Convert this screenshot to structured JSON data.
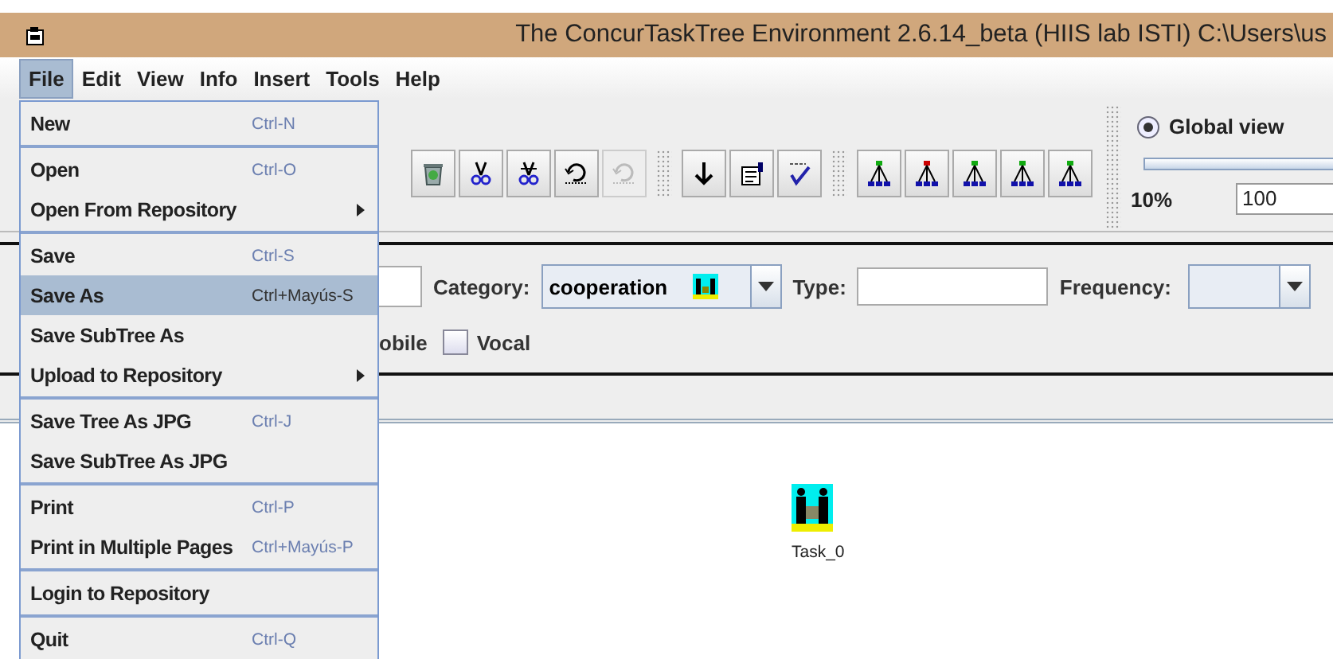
{
  "window": {
    "title": "The ConcurTaskTree Environment 2.6.14_beta (HIIS lab ISTI) C:\\Users\\us"
  },
  "menubar": [
    {
      "label": "File",
      "selected": true
    },
    {
      "label": "Edit",
      "selected": false
    },
    {
      "label": "View",
      "selected": false
    },
    {
      "label": "Info",
      "selected": false
    },
    {
      "label": "Insert",
      "selected": false
    },
    {
      "label": "Tools",
      "selected": false
    },
    {
      "label": "Help",
      "selected": false
    }
  ],
  "file_menu": {
    "groups": [
      [
        {
          "label": "New",
          "shortcut": "Ctrl-N",
          "selected": false,
          "submenu": false
        }
      ],
      [
        {
          "label": "Open",
          "shortcut": "Ctrl-O",
          "selected": false,
          "submenu": false
        },
        {
          "label": "Open From Repository",
          "selected": false,
          "submenu": true
        }
      ],
      [
        {
          "label": "Save",
          "shortcut": "Ctrl-S",
          "selected": false,
          "submenu": false
        },
        {
          "label": "Save As",
          "shortcut": "Ctrl+Mayús-S",
          "selected": true,
          "submenu": false
        },
        {
          "label": "Save SubTree As",
          "selected": false,
          "submenu": false
        },
        {
          "label": "Upload to Repository",
          "selected": false,
          "submenu": true
        }
      ],
      [
        {
          "label": "Save Tree As JPG",
          "shortcut": "Ctrl-J",
          "selected": false,
          "submenu": false
        },
        {
          "label": "Save SubTree As JPG",
          "selected": false,
          "submenu": false
        }
      ],
      [
        {
          "label": "Print",
          "shortcut": "Ctrl-P",
          "selected": false,
          "submenu": false
        },
        {
          "label": "Print in Multiple Pages",
          "shortcut": "Ctrl+Mayús-P",
          "selected": false,
          "submenu": false
        }
      ],
      [
        {
          "label": "Login to Repository",
          "selected": false,
          "submenu": false
        }
      ],
      [
        {
          "label": "Quit",
          "shortcut": "Ctrl-Q",
          "selected": false,
          "submenu": false
        }
      ]
    ]
  },
  "toolbar": {
    "buttons": [
      {
        "disabled": false
      },
      {
        "disabled": false
      },
      {
        "disabled": false
      },
      {
        "disabled": false
      },
      {
        "disabled": true
      },
      {
        "disabled": false
      },
      {
        "disabled": false
      },
      {
        "disabled": false
      },
      {
        "disabled": false
      },
      {
        "disabled": false
      },
      {
        "disabled": false
      },
      {
        "disabled": false
      },
      {
        "disabled": false
      }
    ]
  },
  "view_panel": {
    "global_view": {
      "label": "Global view",
      "selected": true
    },
    "zoom_slider": {
      "level": 1
    },
    "zoom_min": "10%",
    "zoom_value": "100"
  },
  "task_properties": {
    "category_label": "Category:",
    "category": "cooperation",
    "type_label": "Type:",
    "frequency_label": "Frequency:",
    "partial_label": "obile",
    "checkboxes": [
      {
        "label": "Vocal",
        "checked": false
      }
    ]
  },
  "canvas": {
    "tasks": [
      {
        "label": "Task_0",
        "kind": "cooperation"
      }
    ]
  }
}
